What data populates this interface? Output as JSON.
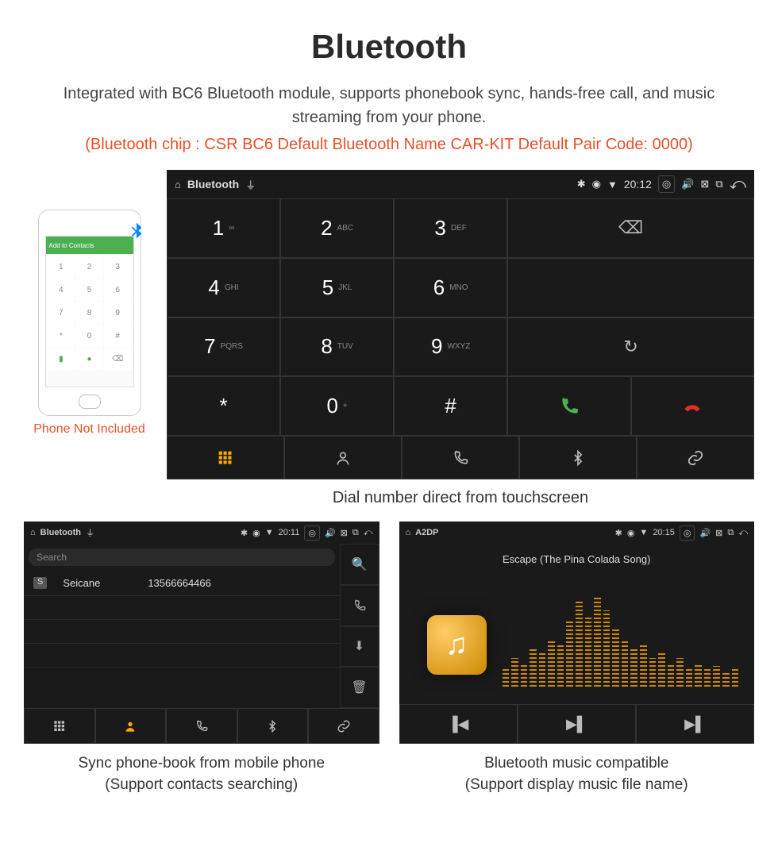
{
  "title": "Bluetooth",
  "subtitle": "Integrated with BC6 Bluetooth module, supports phonebook sync, hands-free call, and music streaming from your phone.",
  "specs": "(Bluetooth chip : CSR BC6     Default Bluetooth Name CAR-KIT     Default Pair Code: 0000)",
  "phone_caption": "Phone Not Included",
  "phone_header": "Add to Contacts",
  "dialer": {
    "sb_title": "Bluetooth",
    "time": "20:12",
    "keys": [
      {
        "d": "1",
        "s": "∞"
      },
      {
        "d": "2",
        "s": "ABC"
      },
      {
        "d": "3",
        "s": "DEF"
      },
      {
        "d": "4",
        "s": "GHI"
      },
      {
        "d": "5",
        "s": "JKL"
      },
      {
        "d": "6",
        "s": "MNO"
      },
      {
        "d": "7",
        "s": "PQRS"
      },
      {
        "d": "8",
        "s": "TUV"
      },
      {
        "d": "9",
        "s": "WXYZ"
      },
      {
        "d": "*",
        "s": ""
      },
      {
        "d": "0",
        "s": "+"
      },
      {
        "d": "#",
        "s": ""
      }
    ],
    "caption": "Dial number direct from touchscreen"
  },
  "contacts": {
    "sb_title": "Bluetooth",
    "time": "20:11",
    "search": "Search",
    "badge": "S",
    "name": "Seicane",
    "number": "13566664466",
    "caption1": "Sync phone-book from mobile phone",
    "caption2": "(Support contacts searching)"
  },
  "music": {
    "sb_title": "A2DP",
    "time": "20:15",
    "song": "Escape (The Pina Colada Song)",
    "caption1": "Bluetooth music compatible",
    "caption2": "(Support display music file name)"
  }
}
